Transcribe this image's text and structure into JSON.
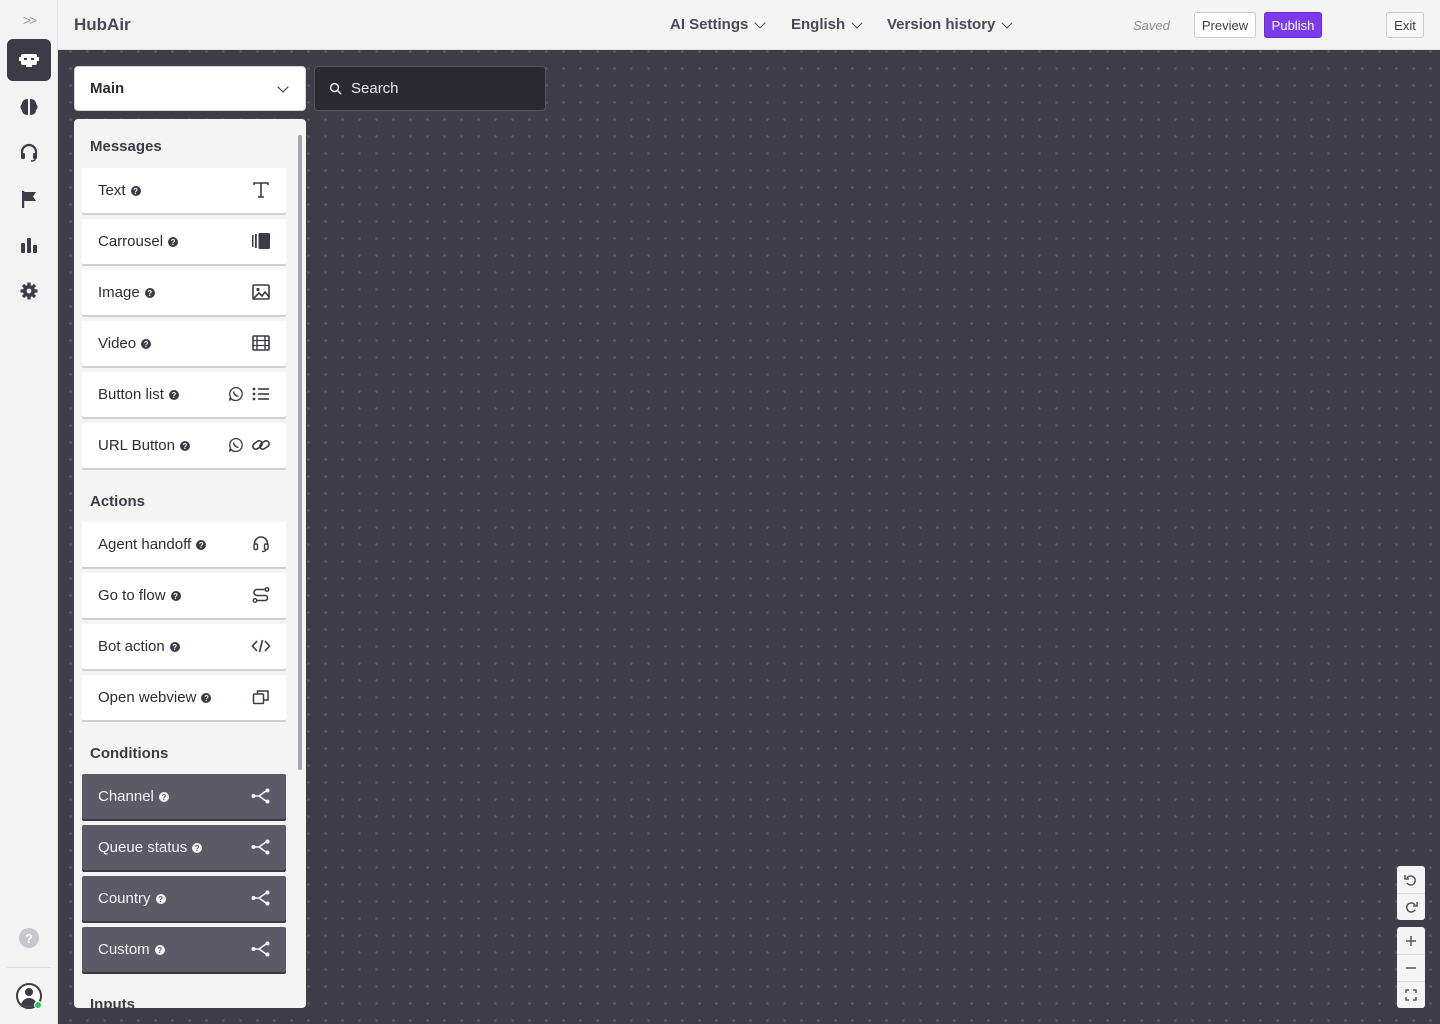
{
  "app": {
    "title": "HubAir"
  },
  "header": {
    "menus": [
      {
        "label": "AI Settings"
      },
      {
        "label": "English"
      },
      {
        "label": "Version history"
      }
    ],
    "status": "Saved",
    "preview_label": "Preview",
    "publish_label": "Publish",
    "exit_label": "Exit"
  },
  "rail": {
    "expand_glyph": ">>",
    "help_glyph": "?",
    "items": [
      {
        "icon": "bot-icon",
        "active": true
      },
      {
        "icon": "brain-icon",
        "active": false
      },
      {
        "icon": "headset-icon",
        "active": false
      },
      {
        "icon": "flag-icon",
        "active": false
      },
      {
        "icon": "bar-chart-icon",
        "active": false
      },
      {
        "icon": "gear-icon",
        "active": false
      }
    ]
  },
  "flow_select": {
    "value": "Main"
  },
  "search": {
    "placeholder": "Search"
  },
  "palette": {
    "messages_title": "Messages",
    "messages": [
      {
        "label": "Text",
        "icon": "text-icon"
      },
      {
        "label": "Carrousel",
        "icon": "carousel-icon"
      },
      {
        "label": "Image",
        "icon": "image-icon"
      },
      {
        "label": "Video",
        "icon": "film-icon"
      },
      {
        "label": "Button list",
        "icon": "list-icon",
        "extra_icon": "whatsapp-icon"
      },
      {
        "label": "URL Button",
        "icon": "link-icon",
        "extra_icon": "whatsapp-icon"
      }
    ],
    "actions_title": "Actions",
    "actions": [
      {
        "label": "Agent handoff",
        "icon": "headset-icon"
      },
      {
        "label": "Go to flow",
        "icon": "route-icon"
      },
      {
        "label": "Bot action",
        "icon": "code-icon"
      },
      {
        "label": "Open webview",
        "icon": "window-icon"
      }
    ],
    "conditions_title": "Conditions",
    "conditions": [
      {
        "label": "Channel",
        "icon": "branch-icon"
      },
      {
        "label": "Queue status",
        "icon": "branch-icon"
      },
      {
        "label": "Country",
        "icon": "branch-icon"
      },
      {
        "label": "Custom",
        "icon": "branch-icon"
      }
    ],
    "inputs_title": "Inputs"
  },
  "colors": {
    "canvas": "#3e3d48",
    "accent": "#7c3aed",
    "rail_active": "#3c3b46",
    "condition_block": "#5b5a66"
  }
}
